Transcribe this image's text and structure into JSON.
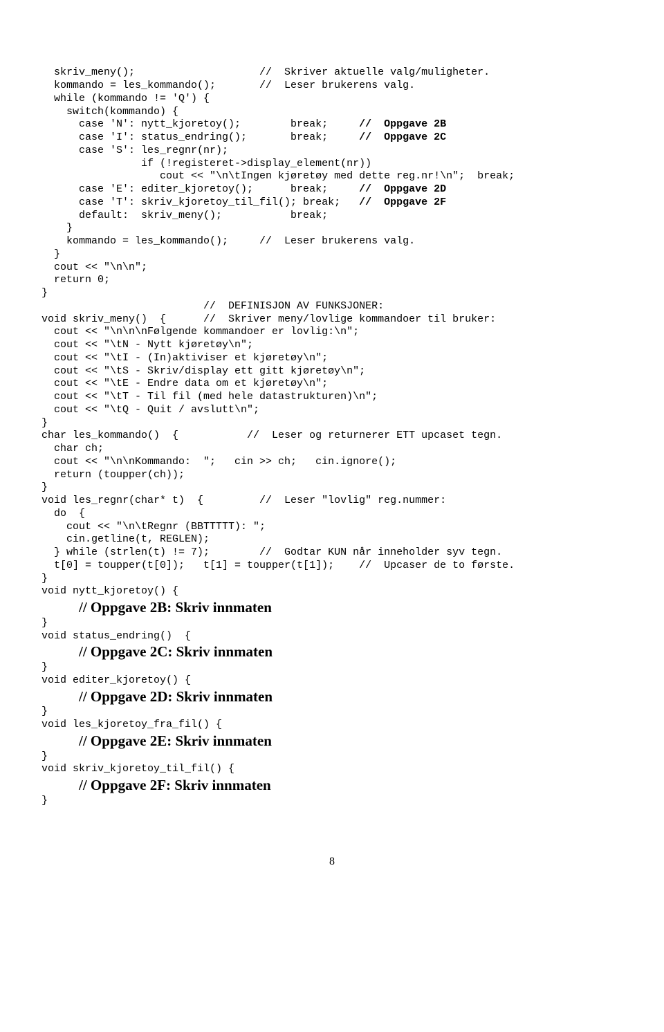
{
  "lines": [
    {
      "text": "  skriv_meny();                    //  Skriver aktuelle valg/muligheter."
    },
    {
      "text": ""
    },
    {
      "text": "  kommando = les_kommando();       //  Leser brukerens valg."
    },
    {
      "text": "  while (kommando != 'Q') {"
    },
    {
      "text": "    switch(kommando) {"
    },
    {
      "prefix": "      case 'N': nytt_kjoretoy();        break;     ",
      "bold": "//  Oppgave 2B"
    },
    {
      "prefix": "      case 'I': status_endring();       break;     ",
      "bold": "//  Oppgave 2C"
    },
    {
      "text": "      case 'S': les_regnr(nr);"
    },
    {
      "text": "                if (!registeret->display_element(nr))"
    },
    {
      "text": "                   cout << \"\\n\\tIngen kjøretøy med dette reg.nr!\\n\";  break;"
    },
    {
      "prefix": "      case 'E': editer_kjoretoy();      break;     ",
      "bold": "//  Oppgave 2D"
    },
    {
      "prefix": "      case 'T': skriv_kjoretoy_til_fil(); break;   ",
      "bold": "//  Oppgave 2F"
    },
    {
      "text": "      default:  skriv_meny();           break;"
    },
    {
      "text": "    }"
    },
    {
      "text": "    kommando = les_kommando();     //  Leser brukerens valg."
    },
    {
      "text": "  }"
    },
    {
      "text": "  cout << \"\\n\\n\";"
    },
    {
      "text": "  return 0;"
    },
    {
      "text": "}"
    },
    {
      "text": ""
    },
    {
      "text": "                          //  DEFINISJON AV FUNKSJONER:"
    },
    {
      "text": "void skriv_meny()  {      //  Skriver meny/lovlige kommandoer til bruker:"
    },
    {
      "text": "  cout << \"\\n\\n\\nFølgende kommandoer er lovlig:\\n\";"
    },
    {
      "text": "  cout << \"\\tN - Nytt kjøretøy\\n\";"
    },
    {
      "text": "  cout << \"\\tI - (In)aktiviser et kjøretøy\\n\";"
    },
    {
      "text": "  cout << \"\\tS - Skriv/display ett gitt kjøretøy\\n\";"
    },
    {
      "text": "  cout << \"\\tE - Endre data om et kjøretøy\\n\";"
    },
    {
      "text": "  cout << \"\\tT - Til fil (med hele datastrukturen)\\n\";"
    },
    {
      "text": "  cout << \"\\tQ - Quit / avslutt\\n\";"
    },
    {
      "text": "}"
    },
    {
      "text": ""
    },
    {
      "text": "char les_kommando()  {           //  Leser og returnerer ETT upcaset tegn."
    },
    {
      "text": "  char ch;"
    },
    {
      "text": "  cout << \"\\n\\nKommando:  \";   cin >> ch;   cin.ignore();"
    },
    {
      "text": "  return (toupper(ch));"
    },
    {
      "text": "}"
    },
    {
      "text": ""
    },
    {
      "text": "void les_regnr(char* t)  {         //  Leser \"lovlig\" reg.nummer:"
    },
    {
      "text": "  do  {"
    },
    {
      "text": "    cout << \"\\n\\tRegnr (BBTTTTT): \";"
    },
    {
      "text": "    cin.getline(t, REGLEN);"
    },
    {
      "text": "  } while (strlen(t) != 7);        //  Godtar KUN når inneholder syv tegn."
    },
    {
      "text": "  t[0] = toupper(t[0]);   t[1] = toupper(t[1]);    //  Upcaser de to første."
    },
    {
      "text": "}"
    },
    {
      "text": ""
    },
    {
      "text": "void nytt_kjoretoy() {"
    },
    {
      "heading": "//  Oppgave 2B: Skriv innmaten"
    },
    {
      "text": "}"
    },
    {
      "text": ""
    },
    {
      "text": "void status_endring()  {"
    },
    {
      "heading": "//  Oppgave 2C: Skriv innmaten"
    },
    {
      "text": "}"
    },
    {
      "text": ""
    },
    {
      "text": "void editer_kjoretoy() {"
    },
    {
      "heading": "//  Oppgave 2D: Skriv innmaten"
    },
    {
      "text": "}"
    },
    {
      "text": ""
    },
    {
      "text": "void les_kjoretoy_fra_fil() {"
    },
    {
      "heading": "//  Oppgave 2E: Skriv innmaten"
    },
    {
      "text": "}"
    },
    {
      "text": ""
    },
    {
      "text": "void skriv_kjoretoy_til_fil() {"
    },
    {
      "heading": "//  Oppgave 2F: Skriv innmaten"
    },
    {
      "text": "}"
    }
  ],
  "page_number": "8"
}
